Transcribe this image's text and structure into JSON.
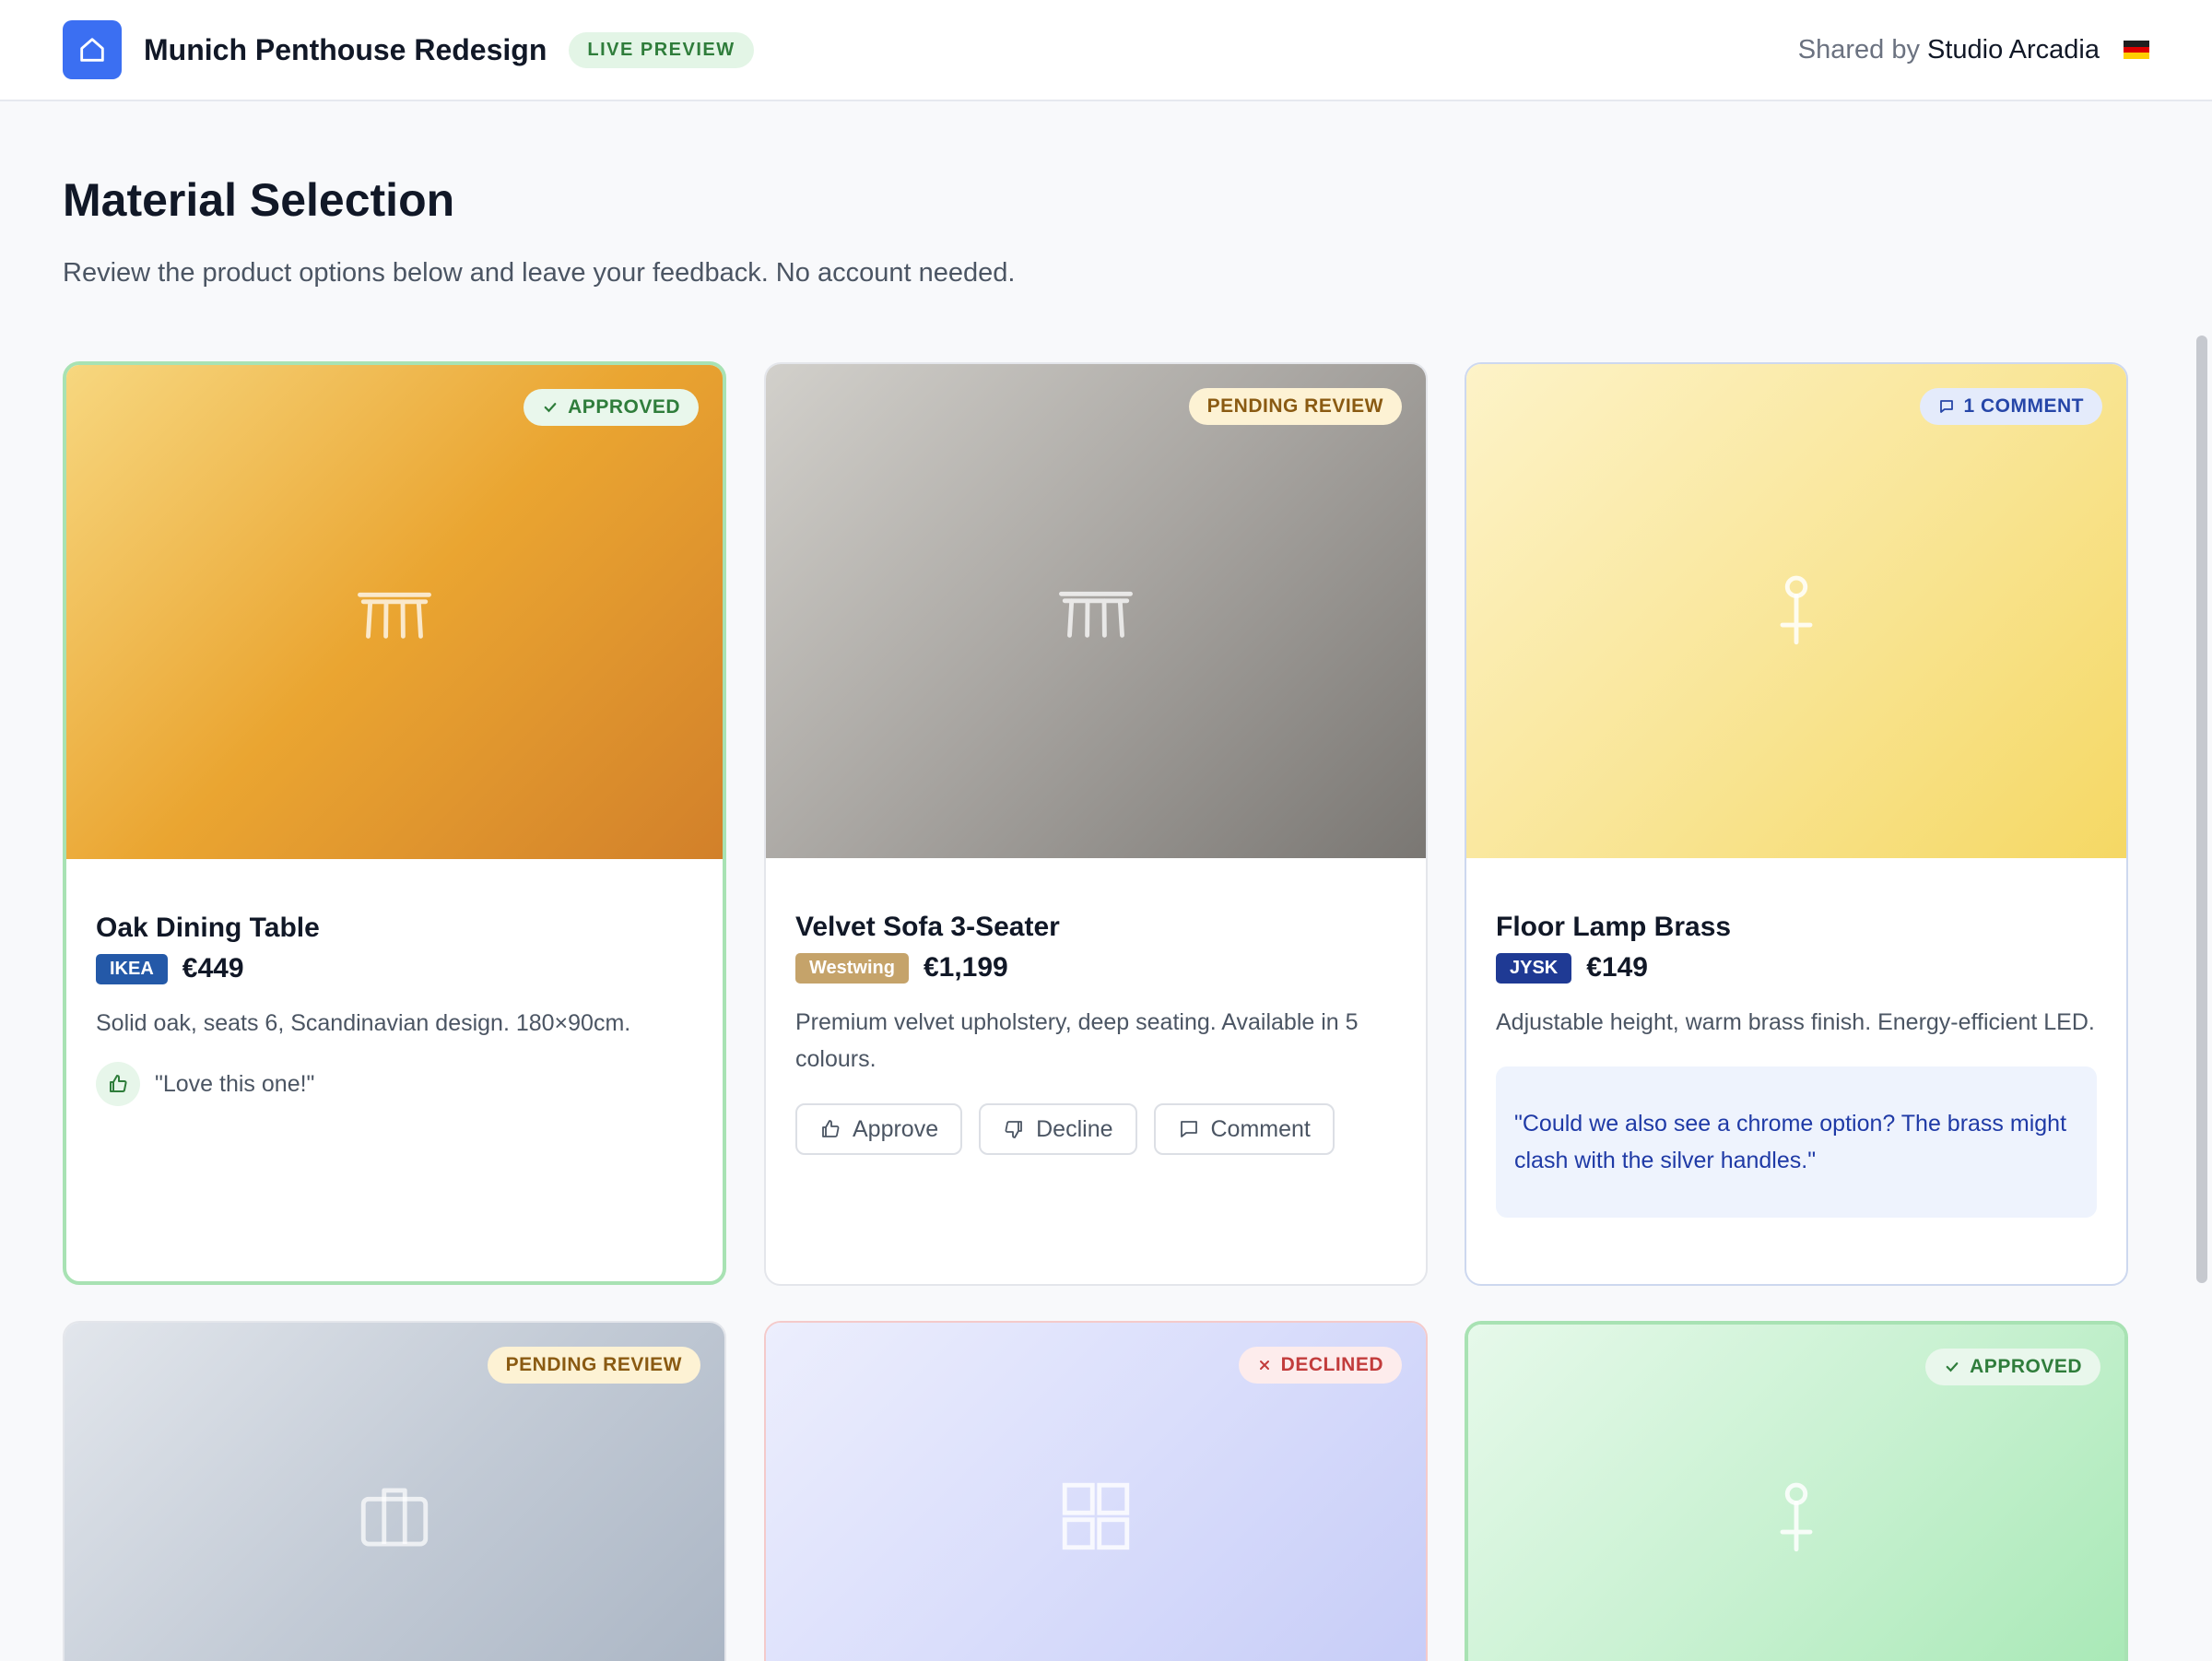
{
  "header": {
    "project_title": "Munich Penthouse Redesign",
    "badge": "LIVE PREVIEW",
    "shared_prefix": "Shared by",
    "shared_by": "Studio Arcadia"
  },
  "page": {
    "title": "Material Selection",
    "subtitle": "Review the product options below and leave your feedback. No account needed."
  },
  "buttons": {
    "approve": "Approve",
    "decline": "Decline",
    "comment": "Comment"
  },
  "products": [
    {
      "name": "Oak Dining Table",
      "vendor": "IKEA",
      "vendor_color": "#2459a8",
      "price": "€449",
      "description": "Solid oak, seats 6, Scandinavian design. 180×90cm.",
      "status": "APPROVED",
      "feedback": "\"Love this one!\"",
      "icon": "table-icon",
      "gradient": [
        "#f7d77f",
        "#eaa531",
        "#d2802a"
      ]
    },
    {
      "name": "Velvet Sofa 3-Seater",
      "vendor": "Westwing",
      "vendor_color": "#c5a36a",
      "price": "€1,199",
      "description": "Premium velvet upholstery, deep seating. Available in 5 colours.",
      "status": "PENDING REVIEW",
      "icon": "table-icon",
      "gradient": [
        "#d2d0cb",
        "#a7a4a0",
        "#7a7773"
      ]
    },
    {
      "name": "Floor Lamp Brass",
      "vendor": "JYSK",
      "vendor_color": "#1f3a94",
      "price": "€149",
      "description": "Adjustable height, warm brass finish. Energy-efficient LED.",
      "status": "1 COMMENT",
      "comment": "\"Could we also see a chrome option? The brass might clash with the silver handles.\"",
      "icon": "lamp-icon",
      "gradient": [
        "#fdf3c8",
        "#f9e699",
        "#f5d864"
      ]
    },
    {
      "status": "PENDING REVIEW",
      "icon": "briefcase-icon",
      "gradient": [
        "#e2e6ec",
        "#c3cbd6",
        "#a9b4c3"
      ]
    },
    {
      "status": "DECLINED",
      "icon": "grid-icon",
      "gradient": [
        "#eceefd",
        "#d9ddfb",
        "#c5cbf7"
      ]
    },
    {
      "status": "APPROVED",
      "icon": "lamp-icon",
      "gradient": [
        "#e6f9ea",
        "#c8f1d1",
        "#a6e8b4"
      ]
    }
  ],
  "colors": {
    "accent": "#3b6ff2",
    "approved": "#2f7d3b",
    "pending": "#8a5a12",
    "comment": "#2646a8",
    "declined": "#c23c3c"
  }
}
